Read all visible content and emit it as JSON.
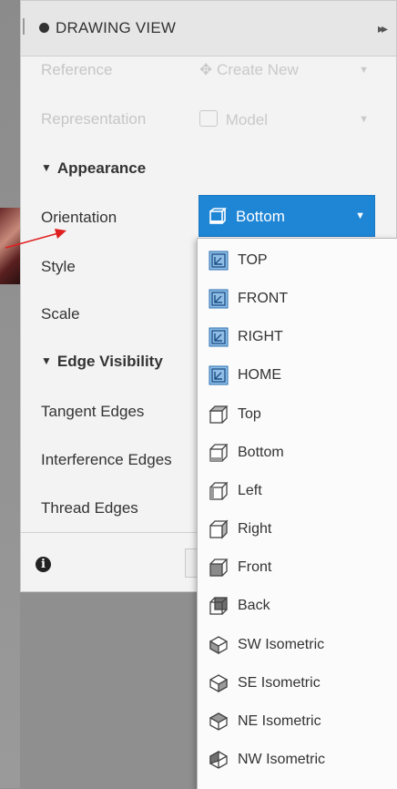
{
  "panel": {
    "title": "DRAWING VIEW",
    "reference": {
      "label": "Reference",
      "value": "Create New"
    },
    "representation": {
      "label": "Representation",
      "value": "Model"
    },
    "appearance": {
      "section_label": "Appearance",
      "orientation": {
        "label": "Orientation",
        "value": "Bottom"
      },
      "style": {
        "label": "Style"
      },
      "scale": {
        "label": "Scale"
      }
    },
    "edge_visibility": {
      "section_label": "Edge Visibility",
      "tangent_edges": {
        "label": "Tangent Edges"
      },
      "interference_edges": {
        "label": "Interference Edges"
      },
      "thread_edges": {
        "label": "Thread Edges"
      }
    },
    "info_glyph": "i"
  },
  "orientation_menu": {
    "items": [
      {
        "label": "TOP",
        "icon": "named-view-icon"
      },
      {
        "label": "FRONT",
        "icon": "named-view-icon"
      },
      {
        "label": "RIGHT",
        "icon": "named-view-icon"
      },
      {
        "label": "HOME",
        "icon": "named-view-icon"
      },
      {
        "label": "Top",
        "icon": "cube-top-icon"
      },
      {
        "label": "Bottom",
        "icon": "cube-bottom-icon"
      },
      {
        "label": "Left",
        "icon": "cube-left-icon"
      },
      {
        "label": "Right",
        "icon": "cube-right-icon"
      },
      {
        "label": "Front",
        "icon": "cube-front-icon"
      },
      {
        "label": "Back",
        "icon": "cube-back-icon"
      },
      {
        "label": "SW Isometric",
        "icon": "isometric-icon"
      },
      {
        "label": "SE Isometric",
        "icon": "isometric-icon"
      },
      {
        "label": "NE Isometric",
        "icon": "isometric-icon"
      },
      {
        "label": "NW Isometric",
        "icon": "isometric-icon"
      }
    ]
  },
  "colors": {
    "accent": "#1f86d6",
    "panel_bg": "#f3f3f3",
    "annotation_arrow": "#e02020"
  }
}
